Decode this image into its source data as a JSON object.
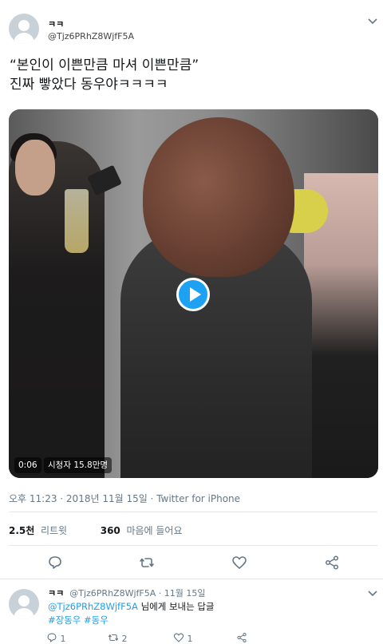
{
  "tweet": {
    "display_name": "ㅋㅋ",
    "handle": "@Tjz6PRhZ8WjfF5A",
    "text_line1": "“본인이 이쁜만큼 마셔 이쁜만큼”",
    "text_line2": "진짜 빻았다 동우야ㅋㅋㅋㅋ",
    "video_duration": "0:06",
    "video_views": "시청자 15.8만명",
    "meta": "오후 11:23 · 2018년 11월 15일 · Twitter for iPhone",
    "retweets_count": "2.5천",
    "retweets_label": "리트윗",
    "likes_count": "360",
    "likes_label": "마음에 들어요"
  },
  "reply": {
    "display_name": "ㅋㅋ",
    "handle_time": "@Tjz6PRhZ8WjfF5A · 11월 15일",
    "reply_to_handle": "@Tjz6PRhZ8WjfF5A",
    "reply_to_suffix": "님에게 보내는 답글",
    "hashtags": "#장동우 #동우",
    "reply_count": "1",
    "retweet_count": "2",
    "like_count": "1"
  },
  "colors": {
    "accent": "#1da1f2",
    "secondary_text": "#657786",
    "divider": "#e1e8ed"
  },
  "icons": [
    "chevron-down-icon",
    "play-icon",
    "reply-icon",
    "retweet-icon",
    "like-icon",
    "share-icon"
  ]
}
